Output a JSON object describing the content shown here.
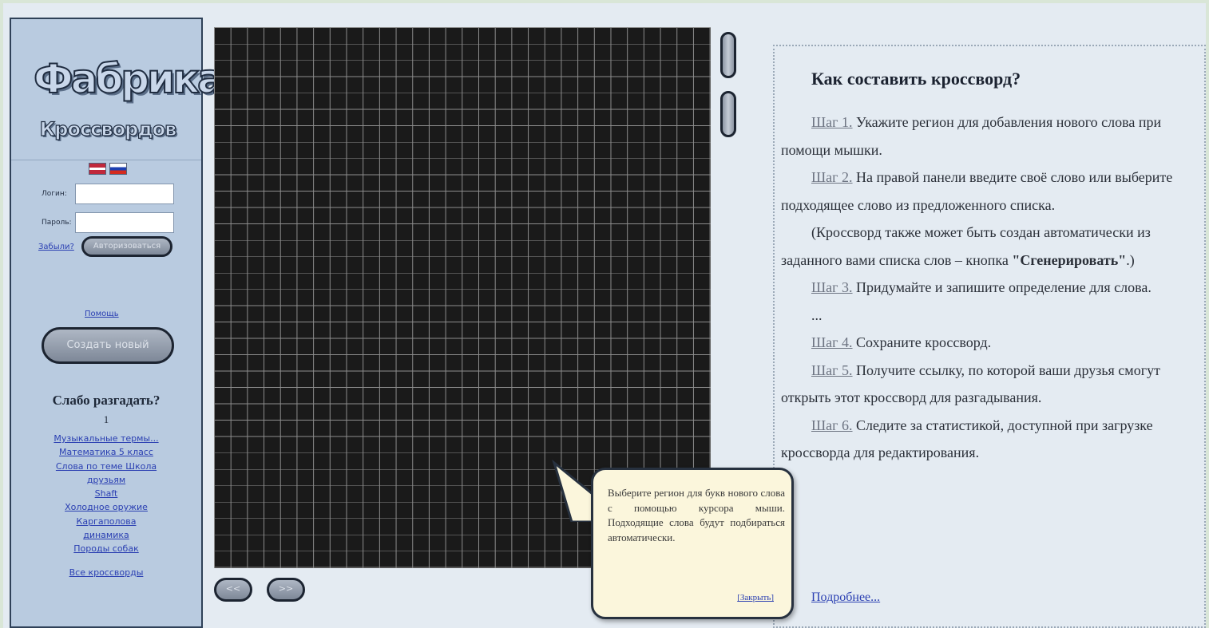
{
  "sidebar": {
    "logo_top": "Фабрика",
    "logo_bottom": "Кроссвордов",
    "login_label": "Логин:",
    "password_label": "Пароль:",
    "forgot_link": "Забыли?",
    "login_button": "Авторизоваться",
    "help_link": "Помощь",
    "create_button": "Создать новый",
    "solve_heading": "Слабо разгадать?",
    "solve_number": "1",
    "crosswords": [
      "Музыкальные термы...",
      "Математика 5 класс",
      "Слова по теме Школа",
      "друзьям",
      "Shaft",
      "Холодное оружие",
      "Каргаполова",
      "динамика",
      "Породы собак",
      "Все кроссворды"
    ]
  },
  "grid": {
    "prev_button": "<<",
    "next_button": ">>"
  },
  "tooltip": {
    "text": "Выберите регион для букв нового слова с помощью курсора мыши. Подходящие слова будут подбираться автоматически.",
    "close_link": "[Закрыть]"
  },
  "help": {
    "title": "Как составить кроссворд?",
    "step1_label": "Шаг 1.",
    "step1_text": " Укажите регион для добавления нового слова при помощи мышки.",
    "step2_label": "Шаг 2.",
    "step2_text": " На правой панели введите своё слово или выберите подходящее слово из предложенного списка.",
    "note_prefix": "(Кроссворд также может быть создан автоматически из заданного вами списка слов – кнопка ",
    "note_bold": "\"Сгенерировать\"",
    "note_suffix": ".)",
    "step3_label": "Шаг 3.",
    "step3_text": " Придумайте и запишите определение для слова.",
    "ellipsis": "...",
    "step4_label": "Шаг 4.",
    "step4_text": " Сохраните кроссворд.",
    "step5_label": "Шаг 5.",
    "step5_text": " Получите ссылку, по которой ваши друзья смогут открыть этот кроссворд для разгадывания.",
    "step6_label": "Шаг 6.",
    "step6_text": " Следите за статистикой, доступной при загрузке кроссворда для редактирования.",
    "more_link": "Подробнее..."
  }
}
